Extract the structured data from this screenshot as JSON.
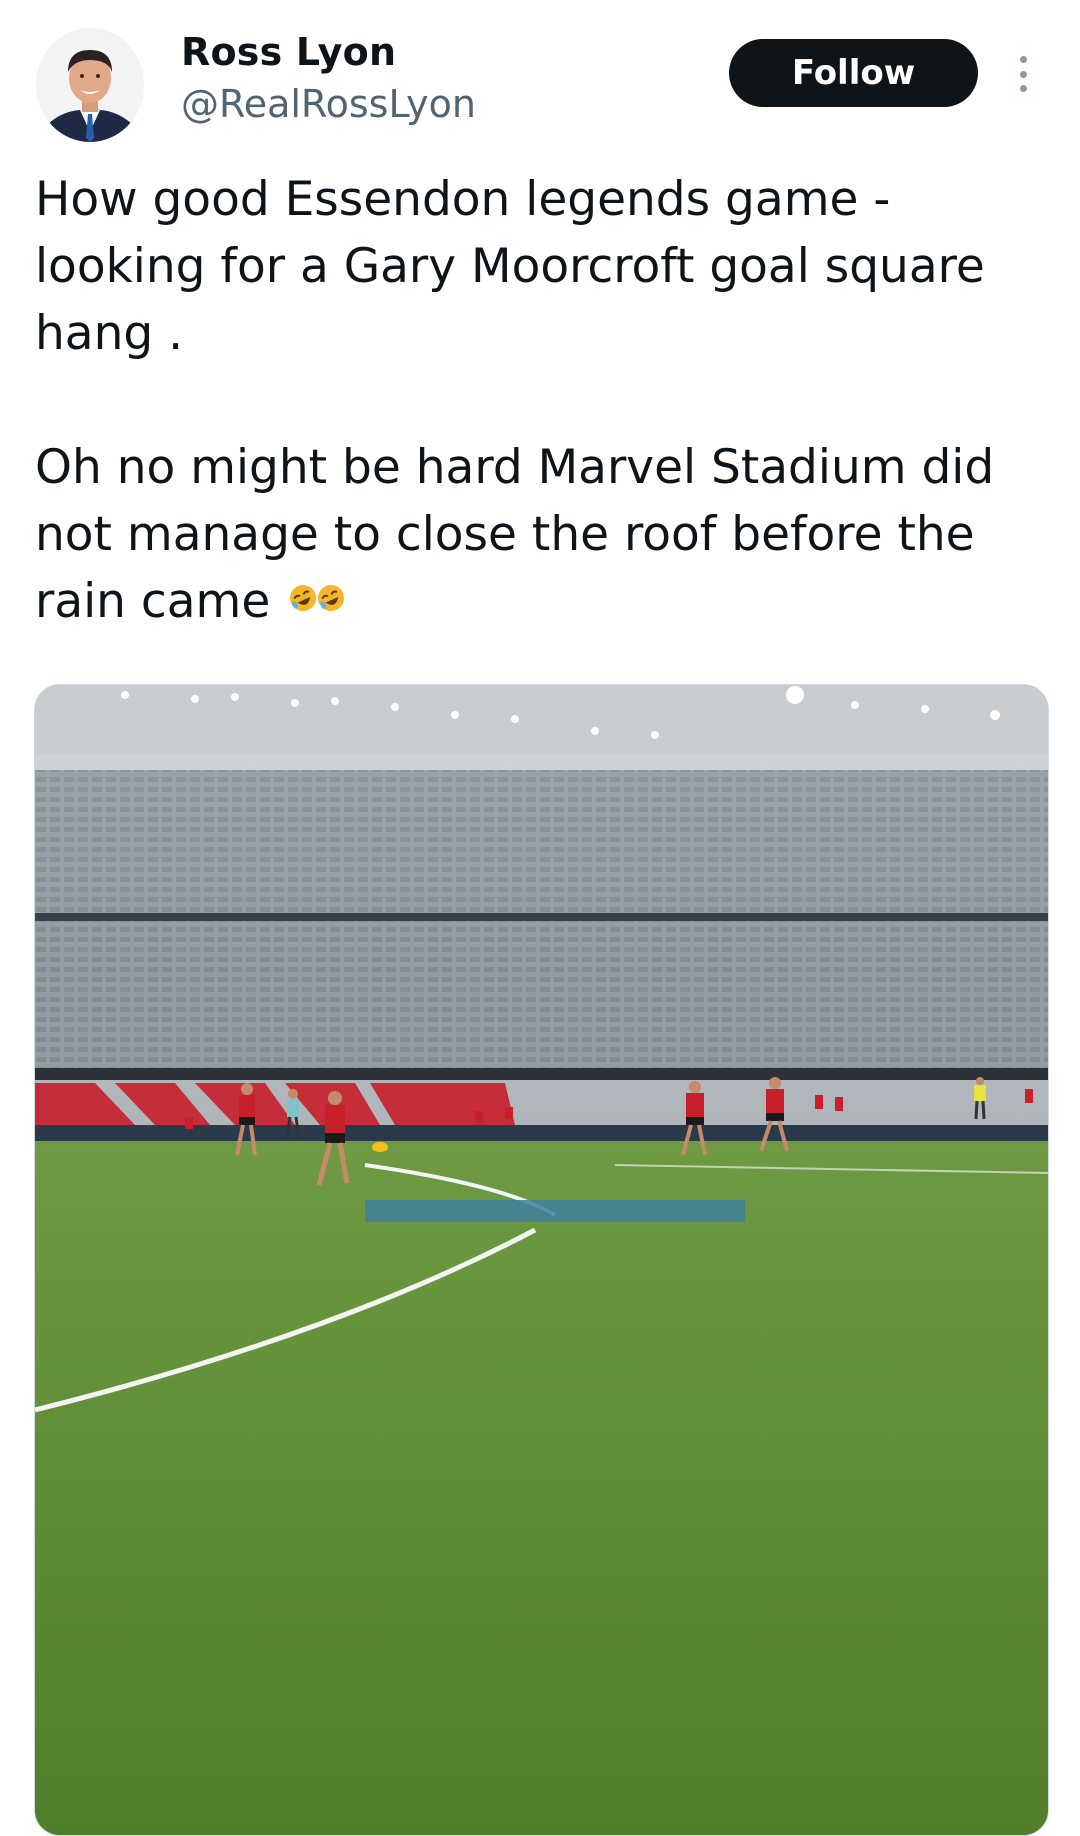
{
  "author": {
    "name": "Ross Lyon",
    "handle": "@RealRossLyon"
  },
  "follow_label": "Follow",
  "tweet": {
    "paragraph_1": "How good Essendon legends game - looking for a Gary Moorcroft goal square hang .",
    "paragraph_2": "Oh no might be hard  Marvel Stadium did not manage to close the roof before the rain came"
  },
  "icons": {
    "more": "more-vertical-icon",
    "emoji": "rolling-on-the-floor-laughing-emoji"
  },
  "colors": {
    "text_primary": "#0f1419",
    "text_secondary": "#536471",
    "follow_button": "#0f1419",
    "grass": "#5d8a35",
    "guernsey_red": "#c8202a"
  }
}
